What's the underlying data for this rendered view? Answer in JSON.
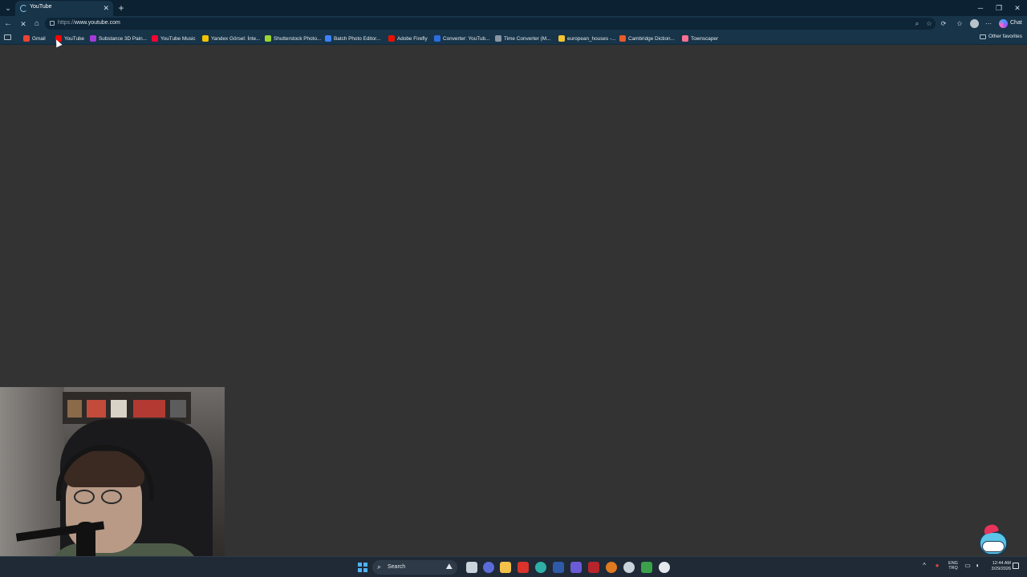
{
  "browser": {
    "tab": {
      "title": "YouTube",
      "close_glyph": "✕"
    },
    "tab_menu_glyph": "⌄",
    "new_tab_glyph": "+",
    "window_controls": {
      "minimize": "─",
      "maximize": "❐",
      "close": "✕"
    },
    "nav": {
      "back": "←",
      "home": "⌂"
    },
    "address": {
      "scheme": "https://",
      "host": "www.youtube.com"
    },
    "toolbar_right": {
      "chat_label": "Chat"
    }
  },
  "bookmarks": {
    "items": [
      {
        "label": "Gmail",
        "icon": "gmail-icon",
        "color": "#ea4335"
      },
      {
        "label": "YouTube",
        "icon": "youtube-icon",
        "color": "#ff0000"
      },
      {
        "label": "Substance 3D Pain...",
        "icon": "substance-icon",
        "color": "#a53bd6"
      },
      {
        "label": "YouTube Music",
        "icon": "youtube-music-icon",
        "color": "#ff0033"
      },
      {
        "label": "Yandex Görsel: İnte...",
        "icon": "yandex-images-icon",
        "color": "#f2c200"
      },
      {
        "label": "Shutterstock Photo...",
        "icon": "shutterstock-icon",
        "color": "#9bd52f"
      },
      {
        "label": "Batch Photo Editor...",
        "icon": "batch-photo-icon",
        "color": "#3b82f6"
      },
      {
        "label": "Adobe Firefly",
        "icon": "adobe-firefly-icon",
        "color": "#eb1000"
      },
      {
        "label": "Converter: YouTub...",
        "icon": "converter-icon",
        "color": "#2d6cdf"
      },
      {
        "label": "Time Converter (M...",
        "icon": "time-converter-icon",
        "color": "#8a96a3"
      },
      {
        "label": "european_houses -...",
        "icon": "european-houses-icon",
        "color": "#f4c430"
      },
      {
        "label": "Cambridge Diction...",
        "icon": "cambridge-icon",
        "color": "#e85a2a"
      },
      {
        "label": "Townscaper",
        "icon": "townscaper-icon",
        "color": "#ff6f91"
      }
    ],
    "other_favorites": "Other favorites"
  },
  "taskbar": {
    "search_label": "Search",
    "language": {
      "line1": "ENG",
      "line2": "TRQ"
    },
    "time": "12:44 AM",
    "date": "3/29/2026"
  }
}
